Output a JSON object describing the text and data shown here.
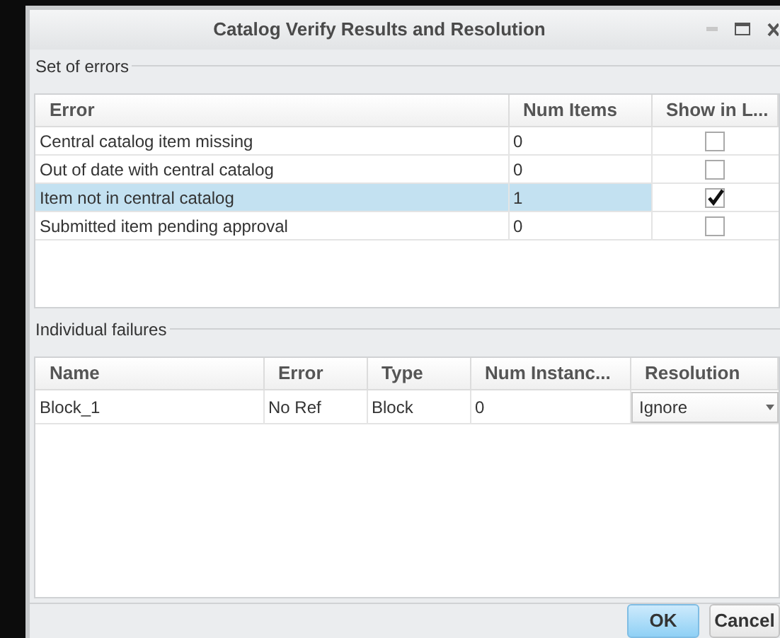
{
  "window": {
    "title": "Catalog Verify Results and Resolution"
  },
  "errors_section": {
    "label": "Set of errors",
    "columns": [
      "Error",
      "Num Items",
      "Show in L..."
    ],
    "rows": [
      {
        "error": "Central catalog item missing",
        "num_items": "0",
        "show": false,
        "selected": false
      },
      {
        "error": "Out of date with central catalog",
        "num_items": "0",
        "show": false,
        "selected": false
      },
      {
        "error": "Item not in central catalog",
        "num_items": "1",
        "show": true,
        "selected": true
      },
      {
        "error": "Submitted item pending approval",
        "num_items": "0",
        "show": false,
        "selected": false
      }
    ]
  },
  "failures_section": {
    "label": "Individual failures",
    "columns": [
      "Name",
      "Error",
      "Type",
      "Num Instanc...",
      "Resolution"
    ],
    "rows": [
      {
        "name": "Block_1",
        "error": "No Ref",
        "type": "Block",
        "num_instances": "0",
        "resolution": "Ignore"
      }
    ]
  },
  "buttons": [
    {
      "label": "OK",
      "kind": "primary"
    },
    {
      "label": "Cancel",
      "kind": "secondary"
    }
  ]
}
